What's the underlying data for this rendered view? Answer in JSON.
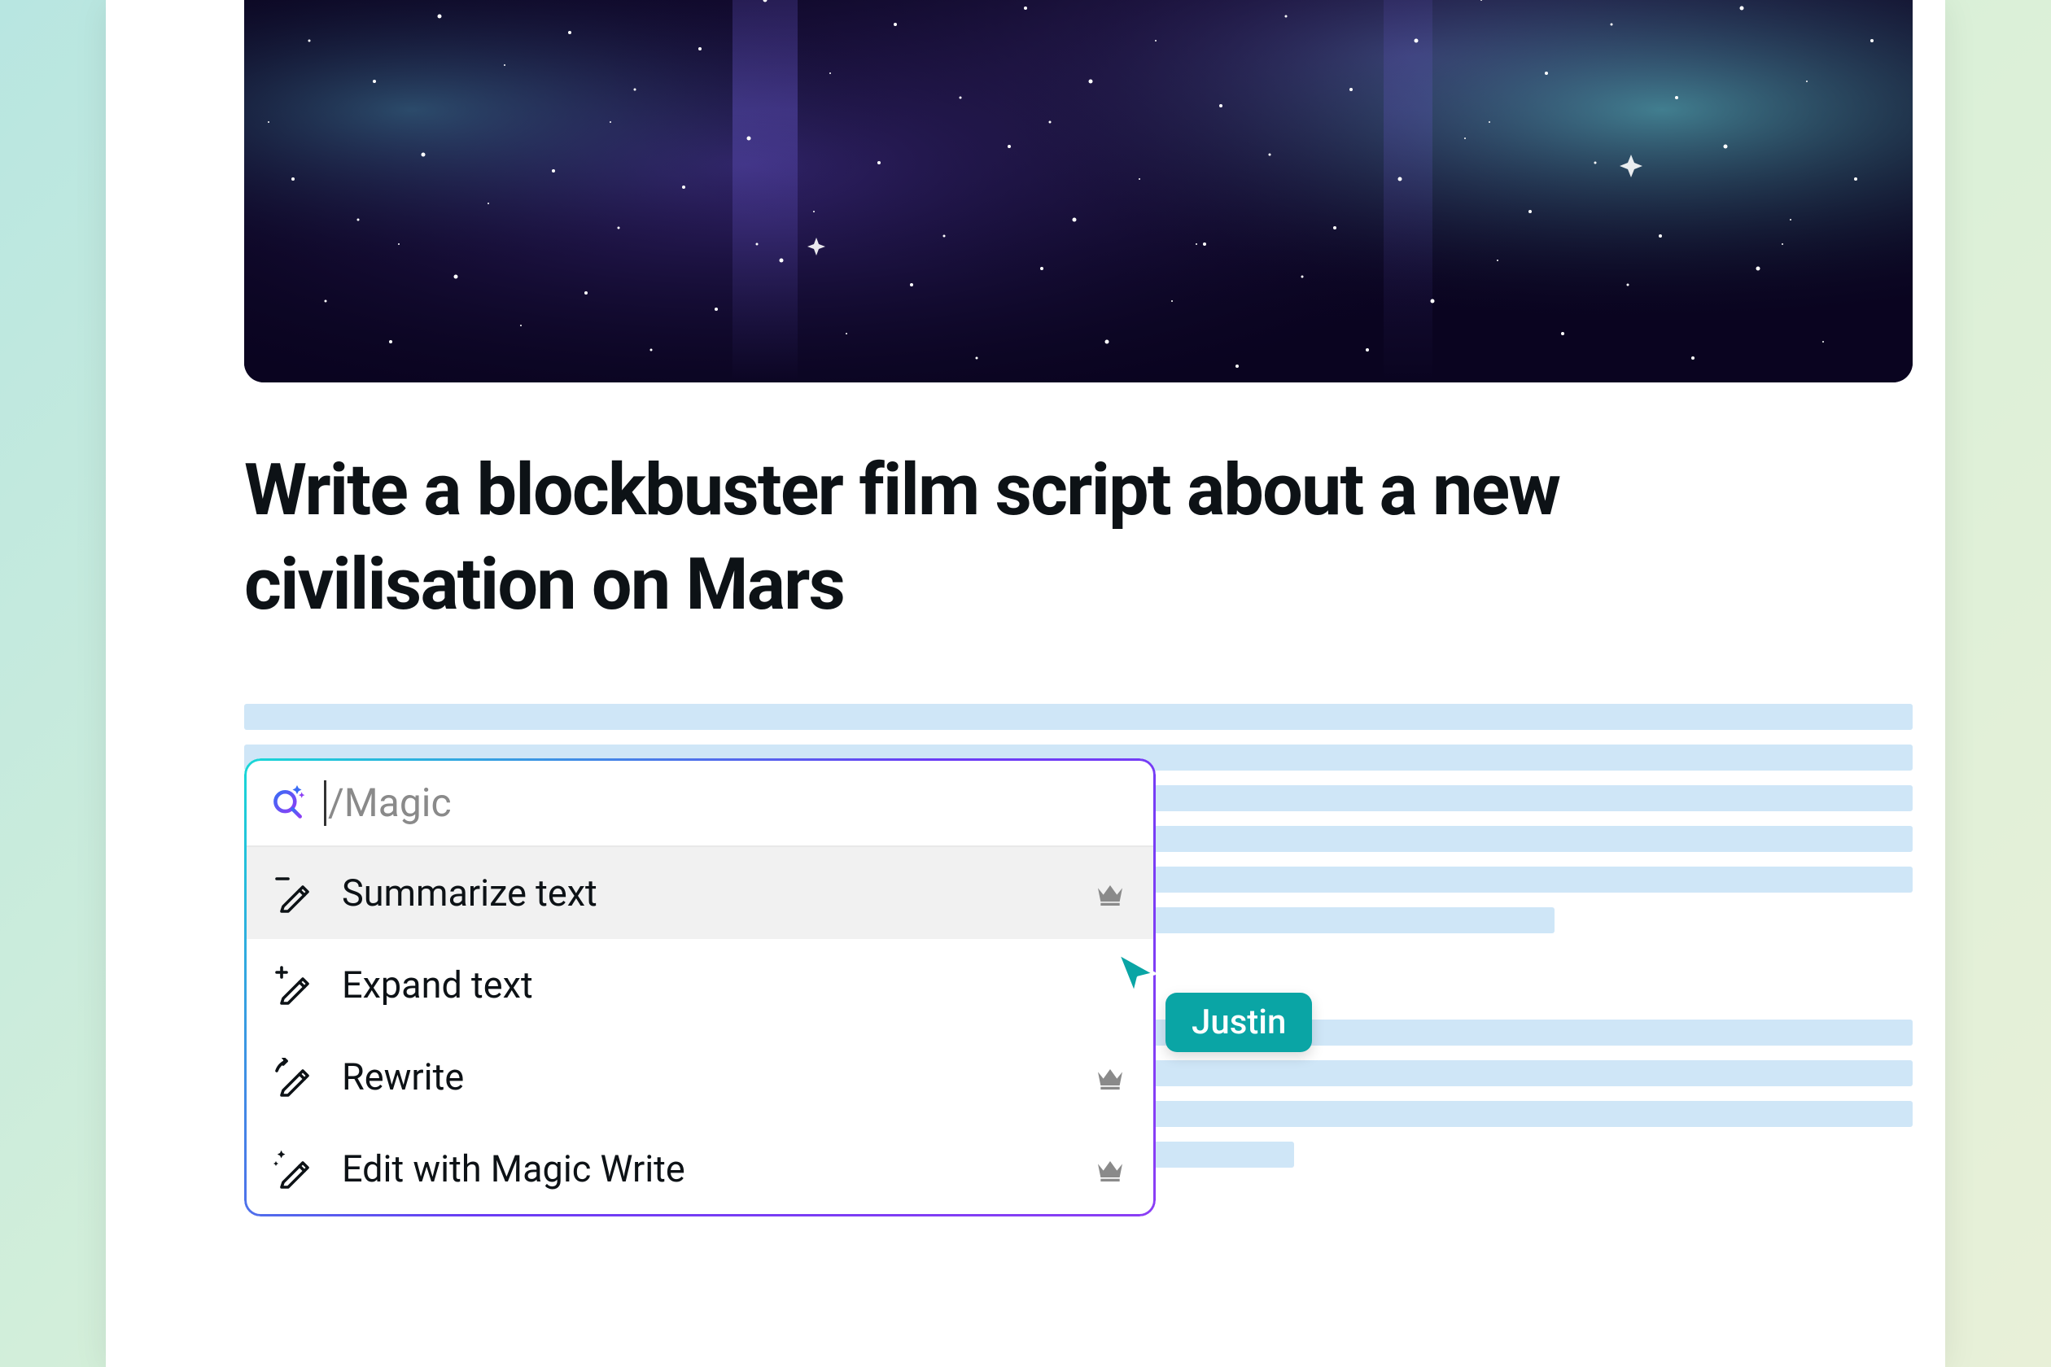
{
  "heading": "Write a blockbuster film script about a new civilisation on Mars",
  "menu": {
    "search_placeholder": "/Magic",
    "items": [
      {
        "label": "Summarize text",
        "icon": "pencil-minus",
        "premium": true,
        "hovered": true
      },
      {
        "label": "Expand text",
        "icon": "pencil-plus",
        "premium": false,
        "hovered": false
      },
      {
        "label": "Rewrite",
        "icon": "pencil-cycle",
        "premium": true,
        "hovered": false
      },
      {
        "label": "Edit with Magic Write",
        "icon": "pencil-sparkle",
        "premium": true,
        "hovered": false
      }
    ]
  },
  "collaborator": {
    "name": "Justin",
    "color": "#0aa5a5"
  }
}
